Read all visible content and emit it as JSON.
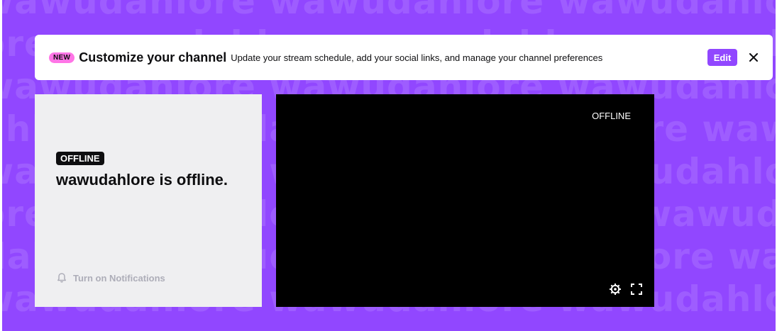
{
  "background": {
    "text_rows": [
      "wawudahlore wawudahlore wawudahlore",
      "ore wawudahlore wawudahlore wawudahlore",
      "wawudahlore wawudahlore wawudahlore",
      "ahlore wawudahlore wawudahlore wawuda",
      "wawudahlore wawudahlore wawudahlore",
      "ore wawudahlore wawudahlore wawudahlore",
      "dahlore wawudahlore wawudahlore wawu",
      "wawudahlore wawudahlore wawudahlore"
    ],
    "color": "#9147ff"
  },
  "banner": {
    "badge": "NEW",
    "title": "Customize your channel",
    "description": "Update your stream schedule, add your social links, and manage your channel preferences",
    "edit_label": "Edit",
    "close_icon": "close-icon"
  },
  "info_card": {
    "status_tag": "OFFLINE",
    "message": "wawudahlore is offline.",
    "notification_label": "Turn on Notifications",
    "notification_icon": "bell-icon"
  },
  "player": {
    "status": "OFFLINE",
    "settings_icon": "gear-icon",
    "fullscreen_icon": "fullscreen-icon"
  }
}
